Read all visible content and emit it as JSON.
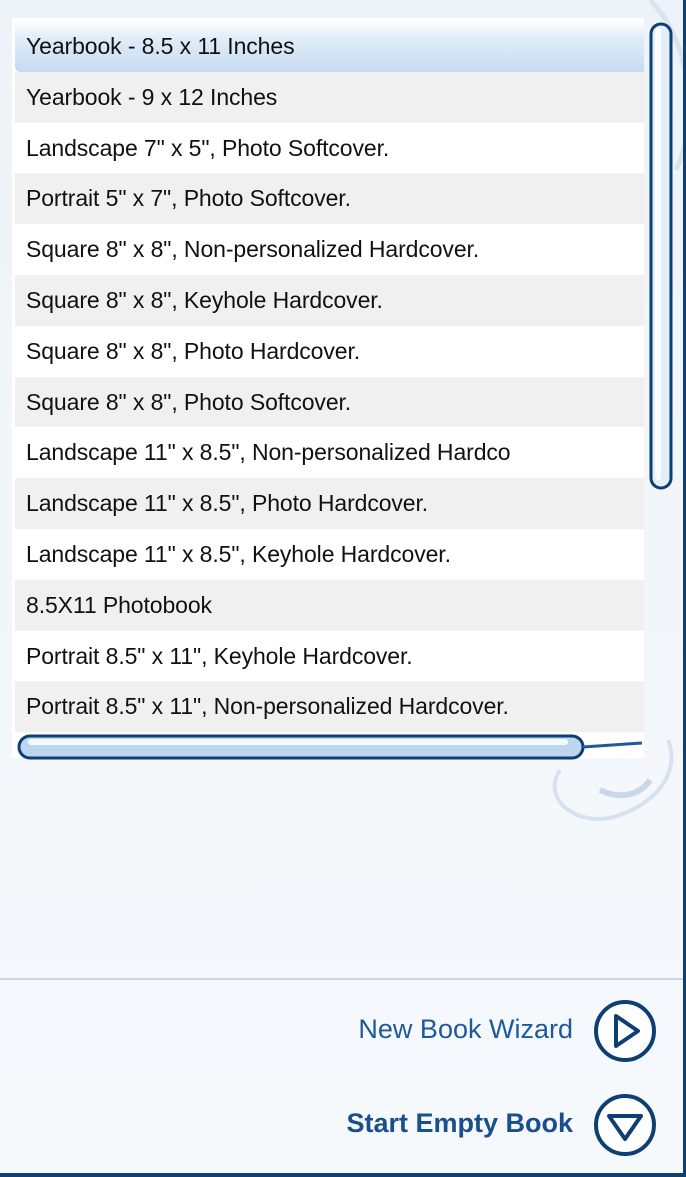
{
  "book_list": {
    "items": [
      {
        "label": "Yearbook - 8.5 x 11 Inches",
        "selected": true
      },
      {
        "label": "Yearbook - 9 x 12 Inches"
      },
      {
        "label": "Landscape 7\" x 5\", Photo Softcover."
      },
      {
        "label": "Portrait 5\" x 7\", Photo Softcover."
      },
      {
        "label": "Square 8\" x 8\", Non-personalized Hardcover."
      },
      {
        "label": "Square 8\" x 8\", Keyhole Hardcover."
      },
      {
        "label": "Square 8\" x 8\", Photo Hardcover."
      },
      {
        "label": "Square 8\" x 8\", Photo Softcover."
      },
      {
        "label": "Landscape 11\" x 8.5\", Non-personalized Hardco"
      },
      {
        "label": "Landscape 11\" x 8.5\", Photo Hardcover."
      },
      {
        "label": "Landscape 11\" x 8.5\", Keyhole Hardcover."
      },
      {
        "label": "8.5X11 Photobook"
      },
      {
        "label": "Portrait 8.5\" x 11\", Keyhole Hardcover."
      },
      {
        "label": "Portrait 8.5\" x 11\", Non-personalized Hardcover."
      }
    ]
  },
  "actions": {
    "wizard_label": "New Book Wizard",
    "wizard_icon": "play-circle-icon",
    "empty_label": "Start Empty Book",
    "empty_icon": "down-triangle-circle-icon"
  },
  "colors": {
    "accent": "#1e5a9b",
    "border": "#0d3f73",
    "selection": "#c6dbf0"
  }
}
